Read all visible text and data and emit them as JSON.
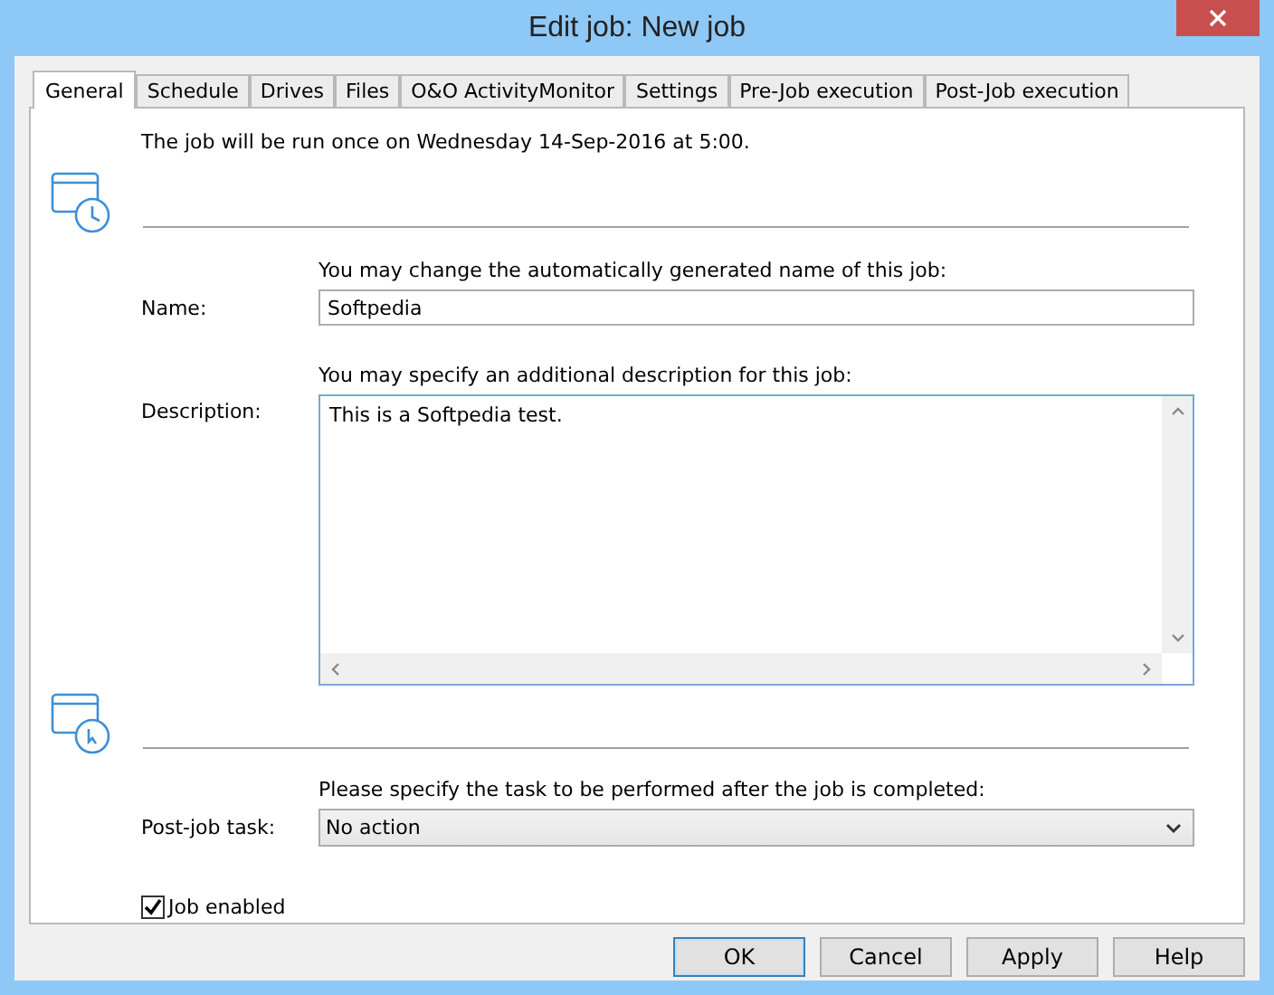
{
  "window": {
    "title": "Edit job: New job"
  },
  "tabs": [
    {
      "label": "General",
      "selected": true
    },
    {
      "label": "Schedule",
      "selected": false
    },
    {
      "label": "Drives",
      "selected": false
    },
    {
      "label": "Files",
      "selected": false
    },
    {
      "label": "O&O ActivityMonitor",
      "selected": false
    },
    {
      "label": "Settings",
      "selected": false
    },
    {
      "label": "Pre-Job execution",
      "selected": false
    },
    {
      "label": "Post-Job execution",
      "selected": false
    }
  ],
  "schedule_info": "The job will be run once on Wednesday 14-Sep-2016 at 5:00.",
  "name": {
    "label": "Name:",
    "hint": "You may change the automatically generated name of this job:",
    "value": "Softpedia"
  },
  "description": {
    "label": "Description:",
    "hint": "You may specify an additional description for this job:",
    "value": "This is a Softpedia test."
  },
  "post_job": {
    "label": "Post-job task:",
    "hint": "Please specify the task to be performed after the job is completed:",
    "value": "No action"
  },
  "job_enabled": {
    "label": "Job enabled",
    "checked": true
  },
  "buttons": [
    {
      "label": "OK",
      "default": true
    },
    {
      "label": "Cancel",
      "default": false
    },
    {
      "label": "Apply",
      "default": false
    },
    {
      "label": "Help",
      "default": false
    }
  ]
}
